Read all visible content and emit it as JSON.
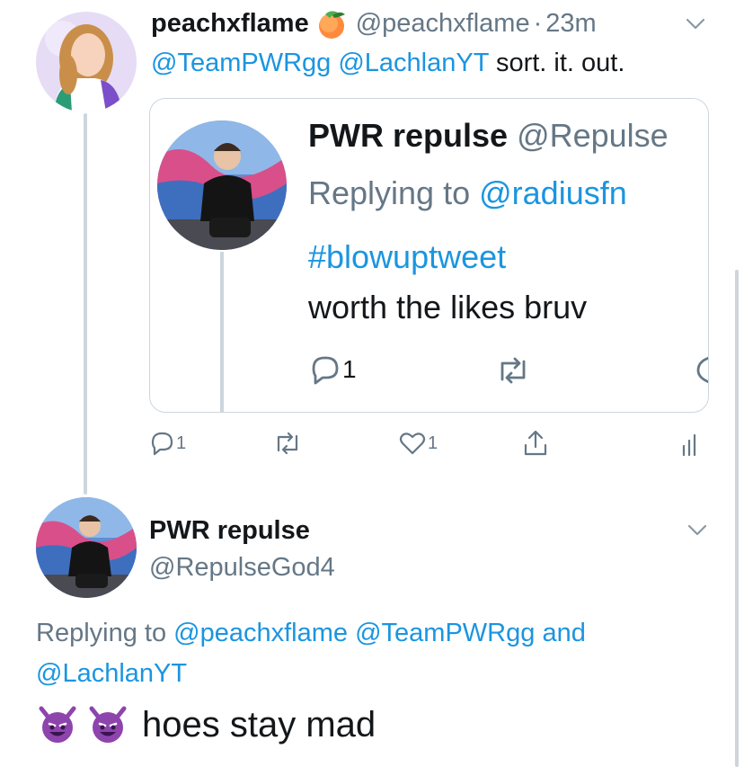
{
  "tweet1": {
    "display_name": "peachxflame",
    "name_emoji": "🍑",
    "handle": "@peachxflame",
    "separator": "·",
    "time": "23m",
    "mentions": [
      "@TeamPWRgg",
      "@LachlanYT"
    ],
    "text": "sort. it. out.",
    "actions": {
      "reply_count": "1",
      "retweet_count": "",
      "like_count": "1"
    },
    "quote": {
      "display_name": "PWR repulse",
      "handle": "@Repulse",
      "replying_prefix": "Replying to",
      "replying_to": "@radiusfn",
      "hashtag": "#blowuptweet",
      "text": "worth the likes bruv",
      "reply_count": "1"
    }
  },
  "tweet2": {
    "display_name": "PWR repulse",
    "handle": "@RepulseGod4",
    "replying_prefix": "Replying to",
    "replying_to": [
      "@peachxflame",
      "@TeamPWRgg"
    ],
    "replying_and": "and",
    "replying_last": "@LachlanYT",
    "emoji": "😈😈",
    "text": "hoes stay mad"
  },
  "colors": {
    "link": "#1b95e0",
    "muted": "#657786",
    "text": "#14171a",
    "border": "#ccd6dd",
    "devil": "#8e44ad"
  },
  "icons": [
    "chevron-down-icon",
    "reply-icon",
    "retweet-icon",
    "like-icon",
    "share-icon",
    "analytics-icon",
    "peach-emoji",
    "smiling-devil-emoji"
  ]
}
